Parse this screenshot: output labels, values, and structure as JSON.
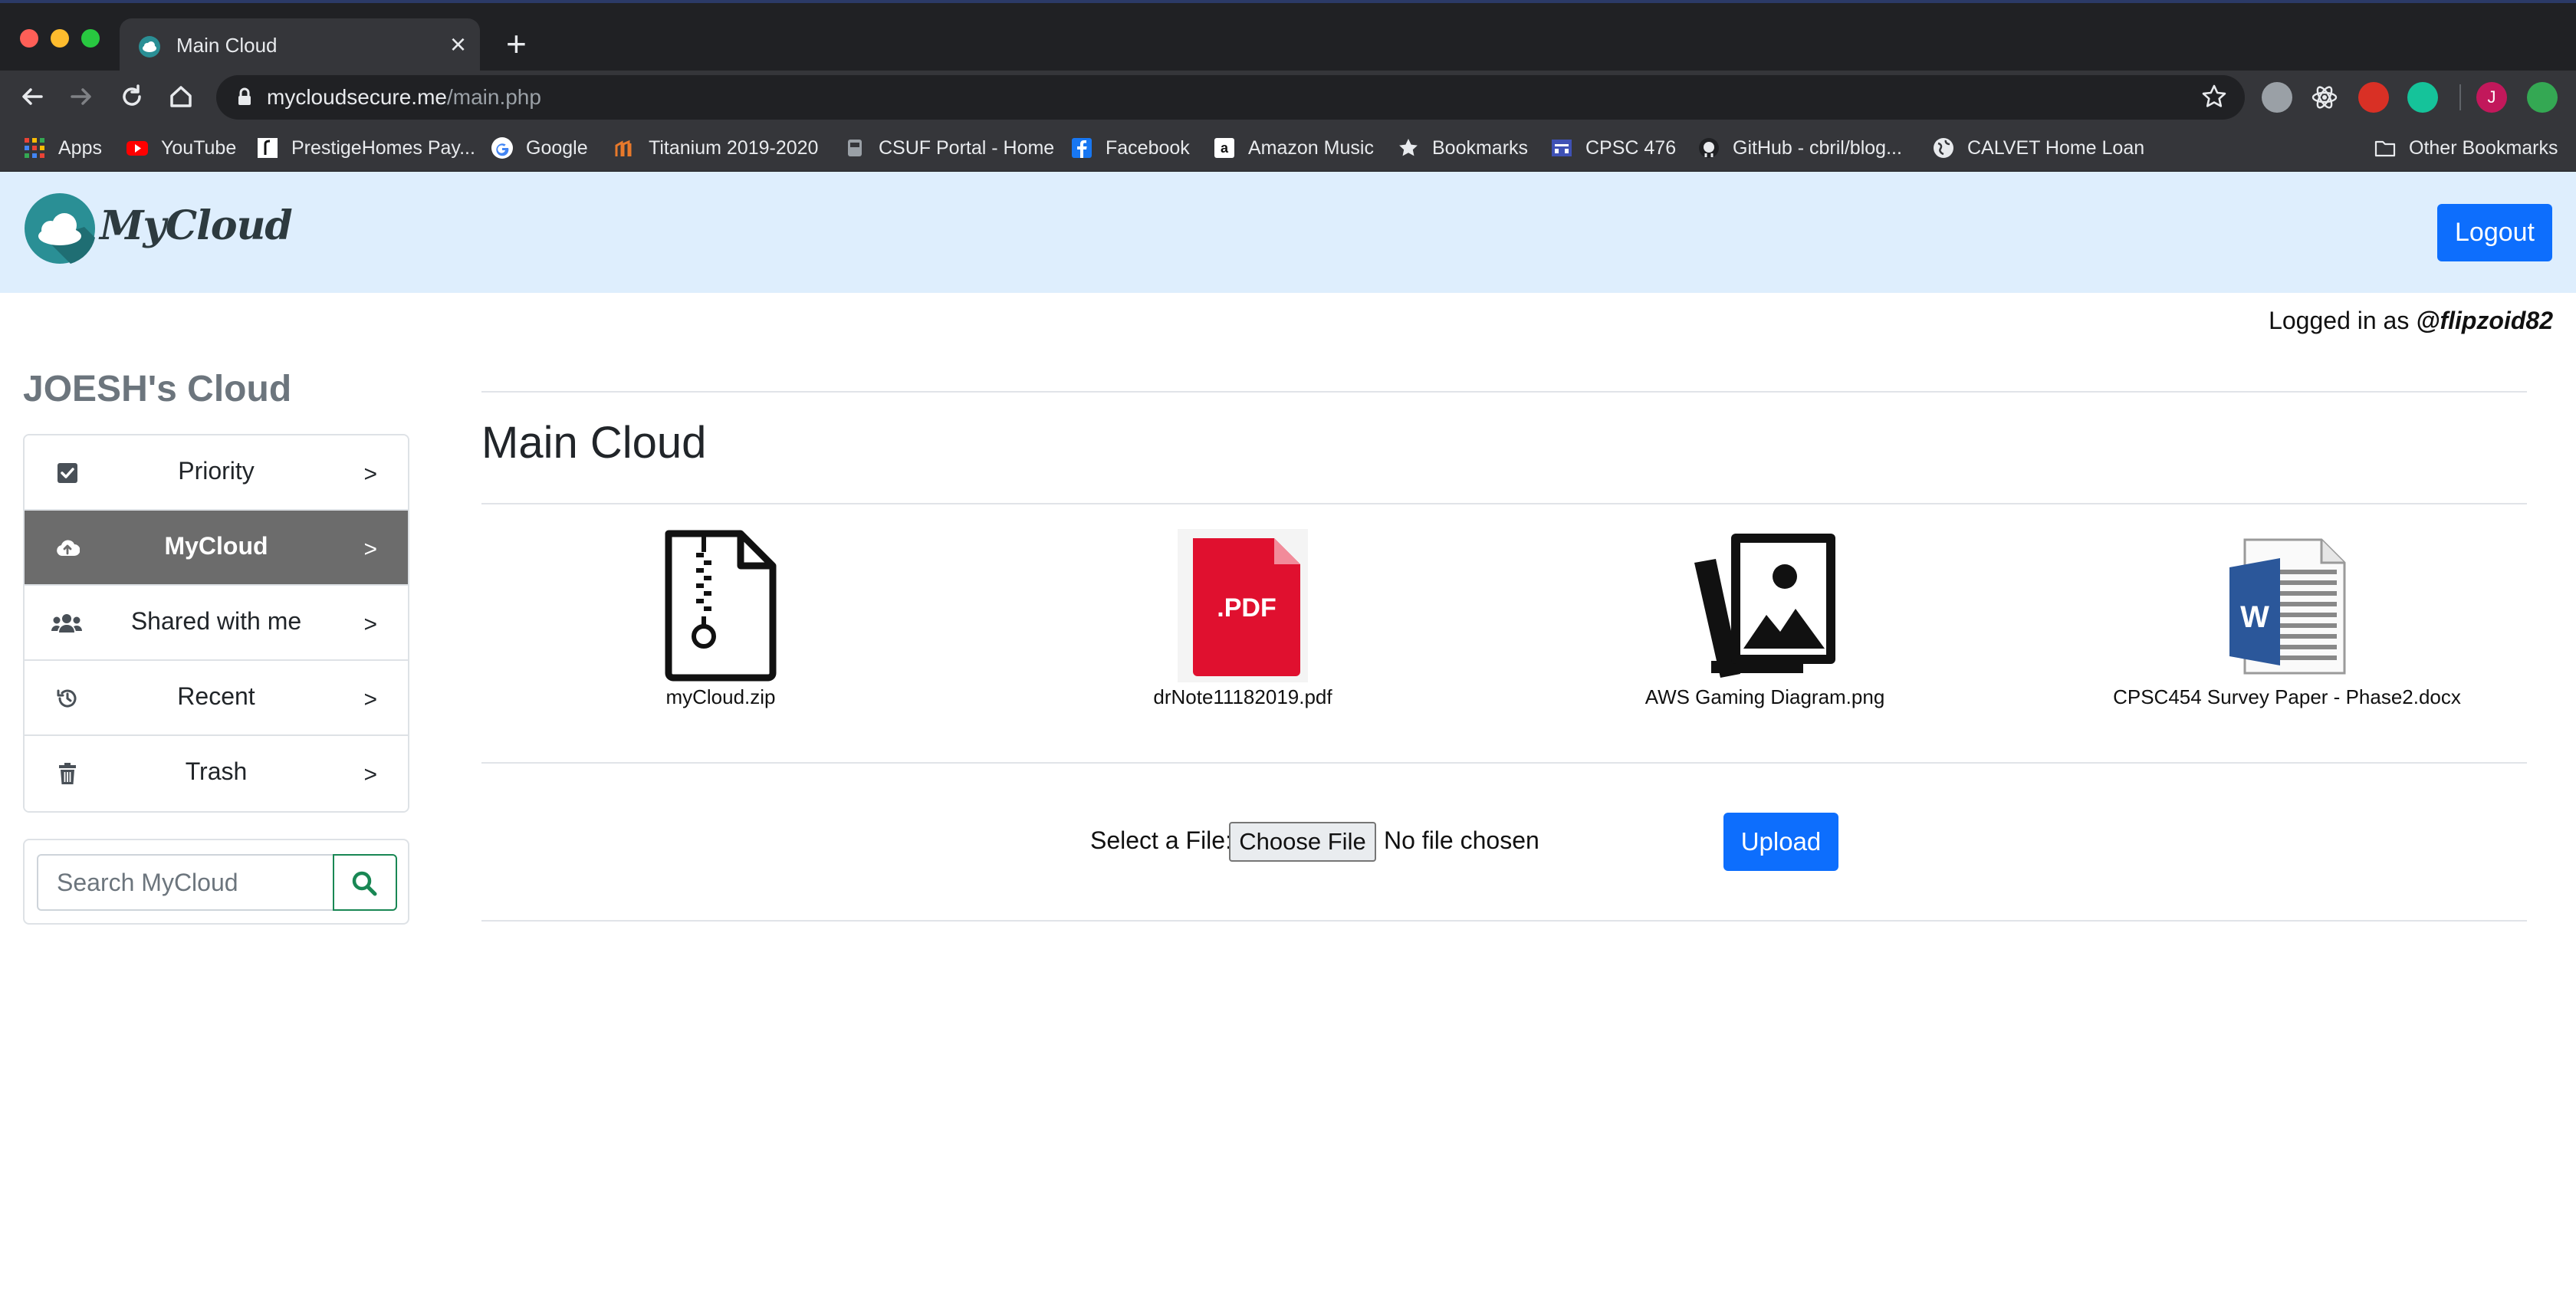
{
  "browser": {
    "tab_title": "Main Cloud",
    "tab_close": "×",
    "new_tab": "+",
    "url_domain": "mycloudsecure.me",
    "url_path": "/main.php",
    "bookmarks": [
      {
        "label": "Apps",
        "icon": "apps-grid-icon"
      },
      {
        "label": "YouTube",
        "icon": "youtube-icon"
      },
      {
        "label": "PrestigeHomes Pay...",
        "icon": "prestige-icon"
      },
      {
        "label": "Google",
        "icon": "google-icon"
      },
      {
        "label": "Titanium 2019-2020",
        "icon": "titanium-icon"
      },
      {
        "label": "CSUF Portal - Home",
        "icon": "csuf-icon"
      },
      {
        "label": "Facebook",
        "icon": "facebook-icon"
      },
      {
        "label": "Amazon Music",
        "icon": "amazon-icon"
      },
      {
        "label": "Bookmarks",
        "icon": "star-icon"
      },
      {
        "label": "CPSC 476",
        "icon": "cpsc-icon"
      },
      {
        "label": "GitHub - cbril/blog...",
        "icon": "github-icon"
      },
      {
        "label": "CALVET Home Loan",
        "icon": "globe-icon"
      }
    ],
    "other_bookmarks": "Other Bookmarks",
    "profile_initial": "J"
  },
  "navbar": {
    "brand": "MyCloud",
    "logout_label": "Logout"
  },
  "user": {
    "prefix": "Logged in as ",
    "handle": "@flipzoid82"
  },
  "sidebar": {
    "title": "JOESH's Cloud",
    "items": [
      {
        "label": "Priority",
        "chevron": ">",
        "icon": "checkbox-icon",
        "active": false
      },
      {
        "label": "MyCloud",
        "chevron": ">",
        "icon": "cloud-upload-icon",
        "active": true
      },
      {
        "label": "Shared with me",
        "chevron": ">",
        "icon": "users-icon",
        "active": false
      },
      {
        "label": "Recent",
        "chevron": ">",
        "icon": "history-icon",
        "active": false
      },
      {
        "label": "Trash",
        "chevron": ">",
        "icon": "trash-icon",
        "active": false
      }
    ],
    "search_placeholder": "Search MyCloud"
  },
  "main": {
    "title": "Main Cloud",
    "files": [
      {
        "name": "myCloud.zip",
        "icon": "zip-file-icon"
      },
      {
        "name": "drNote11182019.pdf",
        "icon": "pdf-file-icon",
        "badge": ".PDF"
      },
      {
        "name": "AWS Gaming Diagram.png",
        "icon": "image-file-icon"
      },
      {
        "name": "CPSC454 Survey Paper - Phase2.docx",
        "icon": "word-file-icon",
        "badge": "W"
      }
    ],
    "upload": {
      "label": "Select a File:",
      "choose_label": "Choose File",
      "no_file_text": "No file chosen",
      "upload_label": "Upload"
    }
  },
  "colors": {
    "navbar_bg": "#deeefd",
    "primary": "#0d6efd",
    "active_item": "#6c6c6c",
    "search_green": "#198754",
    "pdf_red": "#e0102f",
    "word_blue": "#2b579a"
  }
}
